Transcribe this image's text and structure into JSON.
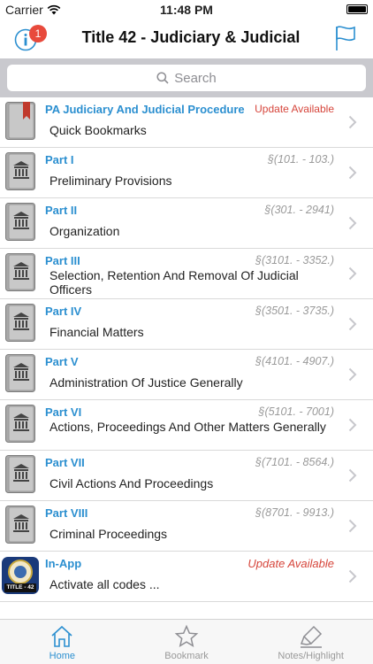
{
  "status_bar": {
    "carrier": "Carrier",
    "time": "11:48 PM"
  },
  "nav": {
    "title": "Title 42 - Judiciary & Judicial",
    "badge_count": "1"
  },
  "search": {
    "placeholder": "Search"
  },
  "rows": [
    {
      "part": "PA Judiciary And Judicial Procedure",
      "range": "Update Available",
      "title": "Quick Bookmarks",
      "icon": "bookmark-book-icon"
    },
    {
      "part": "Part I",
      "range": "§(101. - 103.)",
      "title": "Preliminary Provisions",
      "icon": "courthouse-book-icon"
    },
    {
      "part": "Part II",
      "range": "§(301. - 2941)",
      "title": "Organization",
      "icon": "courthouse-book-icon"
    },
    {
      "part": "Part III",
      "range": "§(3101. - 3352.)",
      "title": "Selection, Retention And Removal Of Judicial Officers",
      "icon": "courthouse-book-icon"
    },
    {
      "part": "Part IV",
      "range": "§(3501. - 3735.)",
      "title": "Financial Matters",
      "icon": "courthouse-book-icon"
    },
    {
      "part": "Part V",
      "range": "§(4101. - 4907.)",
      "title": "Administration Of Justice Generally",
      "icon": "courthouse-book-icon"
    },
    {
      "part": "Part VI",
      "range": "§(5101. - 7001)",
      "title": "Actions, Proceedings And Other Matters Generally",
      "icon": "courthouse-book-icon"
    },
    {
      "part": "Part VII",
      "range": "§(7101. - 8564.)",
      "title": "Civil Actions And Proceedings",
      "icon": "courthouse-book-icon"
    },
    {
      "part": "Part VIII",
      "range": "§(8701. - 9913.)",
      "title": "Criminal Proceedings",
      "icon": "courthouse-book-icon"
    },
    {
      "part": "In-App",
      "range": "Update Available",
      "title": "Activate all codes ...",
      "icon": "state-seal-icon",
      "seal_text": "TITLE - 42"
    }
  ],
  "tabs": [
    {
      "label": "Home",
      "icon": "home-icon",
      "active": true
    },
    {
      "label": "Bookmark",
      "icon": "star-icon",
      "active": false
    },
    {
      "label": "Notes/Highlight",
      "icon": "highlighter-icon",
      "active": false
    }
  ],
  "colors": {
    "accent": "#2b8fd0",
    "update": "#d6453b",
    "badge": "#e84a3c"
  }
}
